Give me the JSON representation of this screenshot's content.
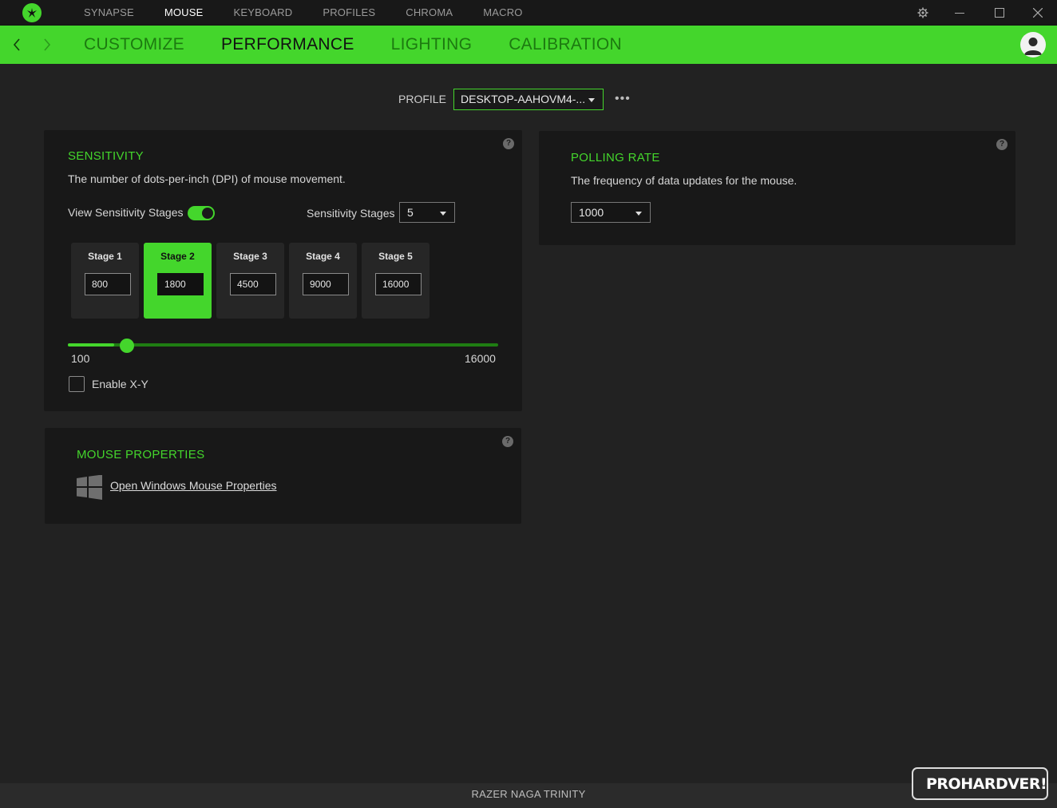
{
  "app": {
    "top_tabs": [
      "SYNAPSE",
      "MOUSE",
      "KEYBOARD",
      "PROFILES",
      "CHROMA",
      "MACRO"
    ],
    "active_top_tab": "MOUSE"
  },
  "subnav": {
    "tabs": [
      "CUSTOMIZE",
      "PERFORMANCE",
      "LIGHTING",
      "CALIBRATION"
    ],
    "active": "PERFORMANCE"
  },
  "profile": {
    "label": "PROFILE",
    "value": "DESKTOP-AAHOVM4-..."
  },
  "sensitivity": {
    "title": "SENSITIVITY",
    "description": "The number of dots-per-inch (DPI) of mouse movement.",
    "view_stages_label": "View Sensitivity Stages",
    "view_stages_enabled": true,
    "stages_label": "Sensitivity Stages",
    "stages_count": "5",
    "stages": [
      {
        "label": "Stage 1",
        "value": "800"
      },
      {
        "label": "Stage 2",
        "value": "1800"
      },
      {
        "label": "Stage 3",
        "value": "4500"
      },
      {
        "label": "Stage 4",
        "value": "9000"
      },
      {
        "label": "Stage 5",
        "value": "16000"
      }
    ],
    "active_stage": 2,
    "slider_min": "100",
    "slider_max": "16000",
    "slider_value": 1800,
    "enable_xy_label": "Enable X-Y",
    "enable_xy_checked": false
  },
  "polling": {
    "title": "POLLING RATE",
    "description": "The frequency of data updates for the mouse.",
    "value": "1000"
  },
  "mouse_properties": {
    "title": "MOUSE PROPERTIES",
    "link": "Open Windows Mouse Properties"
  },
  "status": {
    "device": "RAZER NAGA TRINITY"
  },
  "watermark": {
    "text": "PROHARDVER!"
  },
  "colors": {
    "accent": "#44d62c",
    "background": "#222222",
    "panel": "#181818"
  },
  "icons": [
    "razer-logo-icon",
    "gear-icon",
    "minimize-icon",
    "maximize-icon",
    "close-icon",
    "back-arrow-icon",
    "forward-arrow-icon",
    "user-avatar-icon",
    "help-icon",
    "more-icon",
    "windows-icon"
  ]
}
